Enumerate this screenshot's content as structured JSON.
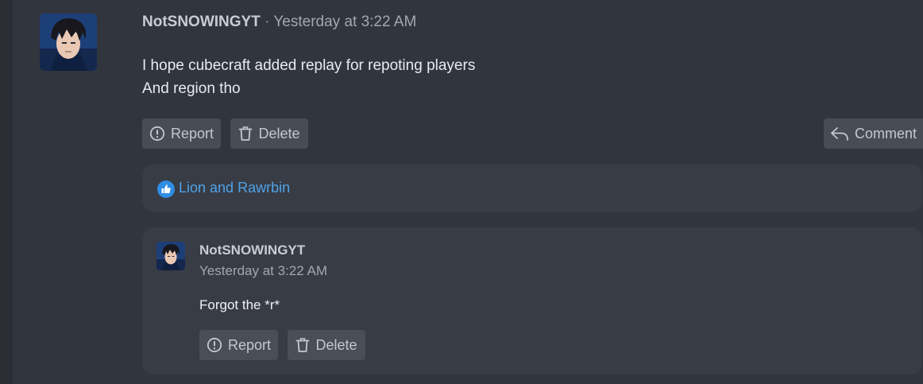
{
  "post": {
    "author": "NotSNOWINGYT",
    "separator": "·",
    "timestamp": "Yesterday at 3:22 AM",
    "body_lines": [
      "I hope cubecraft added replay for repoting players",
      "And region tho"
    ],
    "actions": {
      "report_label": "Report",
      "delete_label": "Delete",
      "comment_label": "Comment"
    }
  },
  "reactions": {
    "icon": "thumbs-up-icon",
    "text": "Lion and Rawrbin",
    "color": "#4fa3e8"
  },
  "reply": {
    "author": "NotSNOWINGYT",
    "timestamp": "Yesterday at 3:22 AM",
    "body": "Forgot the *r*",
    "actions": {
      "report_label": "Report",
      "delete_label": "Delete"
    }
  },
  "icons": {
    "report": "exclamation-circle-icon",
    "delete": "trash-icon",
    "comment": "reply-arrow-icon"
  }
}
